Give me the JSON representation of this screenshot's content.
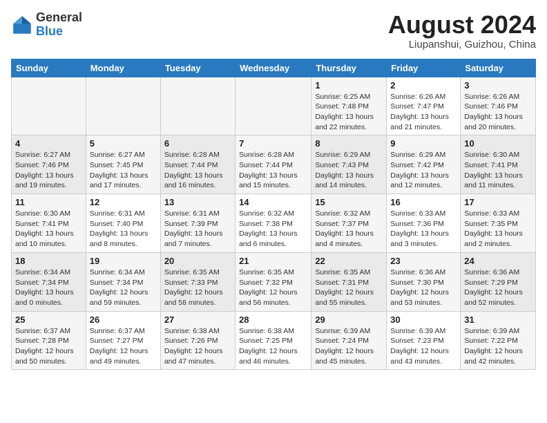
{
  "header": {
    "logo_general": "General",
    "logo_blue": "Blue",
    "title": "August 2024",
    "subtitle": "Liupanshui, Guizhou, China"
  },
  "days_of_week": [
    "Sunday",
    "Monday",
    "Tuesday",
    "Wednesday",
    "Thursday",
    "Friday",
    "Saturday"
  ],
  "weeks": [
    [
      {
        "day": "",
        "info": ""
      },
      {
        "day": "",
        "info": ""
      },
      {
        "day": "",
        "info": ""
      },
      {
        "day": "",
        "info": ""
      },
      {
        "day": "1",
        "info": "Sunrise: 6:25 AM\nSunset: 7:48 PM\nDaylight: 13 hours and 22 minutes."
      },
      {
        "day": "2",
        "info": "Sunrise: 6:26 AM\nSunset: 7:47 PM\nDaylight: 13 hours and 21 minutes."
      },
      {
        "day": "3",
        "info": "Sunrise: 6:26 AM\nSunset: 7:46 PM\nDaylight: 13 hours and 20 minutes."
      }
    ],
    [
      {
        "day": "4",
        "info": "Sunrise: 6:27 AM\nSunset: 7:46 PM\nDaylight: 13 hours and 19 minutes."
      },
      {
        "day": "5",
        "info": "Sunrise: 6:27 AM\nSunset: 7:45 PM\nDaylight: 13 hours and 17 minutes."
      },
      {
        "day": "6",
        "info": "Sunrise: 6:28 AM\nSunset: 7:44 PM\nDaylight: 13 hours and 16 minutes."
      },
      {
        "day": "7",
        "info": "Sunrise: 6:28 AM\nSunset: 7:44 PM\nDaylight: 13 hours and 15 minutes."
      },
      {
        "day": "8",
        "info": "Sunrise: 6:29 AM\nSunset: 7:43 PM\nDaylight: 13 hours and 14 minutes."
      },
      {
        "day": "9",
        "info": "Sunrise: 6:29 AM\nSunset: 7:42 PM\nDaylight: 13 hours and 12 minutes."
      },
      {
        "day": "10",
        "info": "Sunrise: 6:30 AM\nSunset: 7:41 PM\nDaylight: 13 hours and 11 minutes."
      }
    ],
    [
      {
        "day": "11",
        "info": "Sunrise: 6:30 AM\nSunset: 7:41 PM\nDaylight: 13 hours and 10 minutes."
      },
      {
        "day": "12",
        "info": "Sunrise: 6:31 AM\nSunset: 7:40 PM\nDaylight: 13 hours and 8 minutes."
      },
      {
        "day": "13",
        "info": "Sunrise: 6:31 AM\nSunset: 7:39 PM\nDaylight: 13 hours and 7 minutes."
      },
      {
        "day": "14",
        "info": "Sunrise: 6:32 AM\nSunset: 7:38 PM\nDaylight: 13 hours and 6 minutes."
      },
      {
        "day": "15",
        "info": "Sunrise: 6:32 AM\nSunset: 7:37 PM\nDaylight: 13 hours and 4 minutes."
      },
      {
        "day": "16",
        "info": "Sunrise: 6:33 AM\nSunset: 7:36 PM\nDaylight: 13 hours and 3 minutes."
      },
      {
        "day": "17",
        "info": "Sunrise: 6:33 AM\nSunset: 7:35 PM\nDaylight: 13 hours and 2 minutes."
      }
    ],
    [
      {
        "day": "18",
        "info": "Sunrise: 6:34 AM\nSunset: 7:34 PM\nDaylight: 13 hours and 0 minutes."
      },
      {
        "day": "19",
        "info": "Sunrise: 6:34 AM\nSunset: 7:34 PM\nDaylight: 12 hours and 59 minutes."
      },
      {
        "day": "20",
        "info": "Sunrise: 6:35 AM\nSunset: 7:33 PM\nDaylight: 12 hours and 58 minutes."
      },
      {
        "day": "21",
        "info": "Sunrise: 6:35 AM\nSunset: 7:32 PM\nDaylight: 12 hours and 56 minutes."
      },
      {
        "day": "22",
        "info": "Sunrise: 6:35 AM\nSunset: 7:31 PM\nDaylight: 12 hours and 55 minutes."
      },
      {
        "day": "23",
        "info": "Sunrise: 6:36 AM\nSunset: 7:30 PM\nDaylight: 12 hours and 53 minutes."
      },
      {
        "day": "24",
        "info": "Sunrise: 6:36 AM\nSunset: 7:29 PM\nDaylight: 12 hours and 52 minutes."
      }
    ],
    [
      {
        "day": "25",
        "info": "Sunrise: 6:37 AM\nSunset: 7:28 PM\nDaylight: 12 hours and 50 minutes."
      },
      {
        "day": "26",
        "info": "Sunrise: 6:37 AM\nSunset: 7:27 PM\nDaylight: 12 hours and 49 minutes."
      },
      {
        "day": "27",
        "info": "Sunrise: 6:38 AM\nSunset: 7:26 PM\nDaylight: 12 hours and 47 minutes."
      },
      {
        "day": "28",
        "info": "Sunrise: 6:38 AM\nSunset: 7:25 PM\nDaylight: 12 hours and 46 minutes."
      },
      {
        "day": "29",
        "info": "Sunrise: 6:39 AM\nSunset: 7:24 PM\nDaylight: 12 hours and 45 minutes."
      },
      {
        "day": "30",
        "info": "Sunrise: 6:39 AM\nSunset: 7:23 PM\nDaylight: 12 hours and 43 minutes."
      },
      {
        "day": "31",
        "info": "Sunrise: 6:39 AM\nSunset: 7:22 PM\nDaylight: 12 hours and 42 minutes."
      }
    ]
  ]
}
